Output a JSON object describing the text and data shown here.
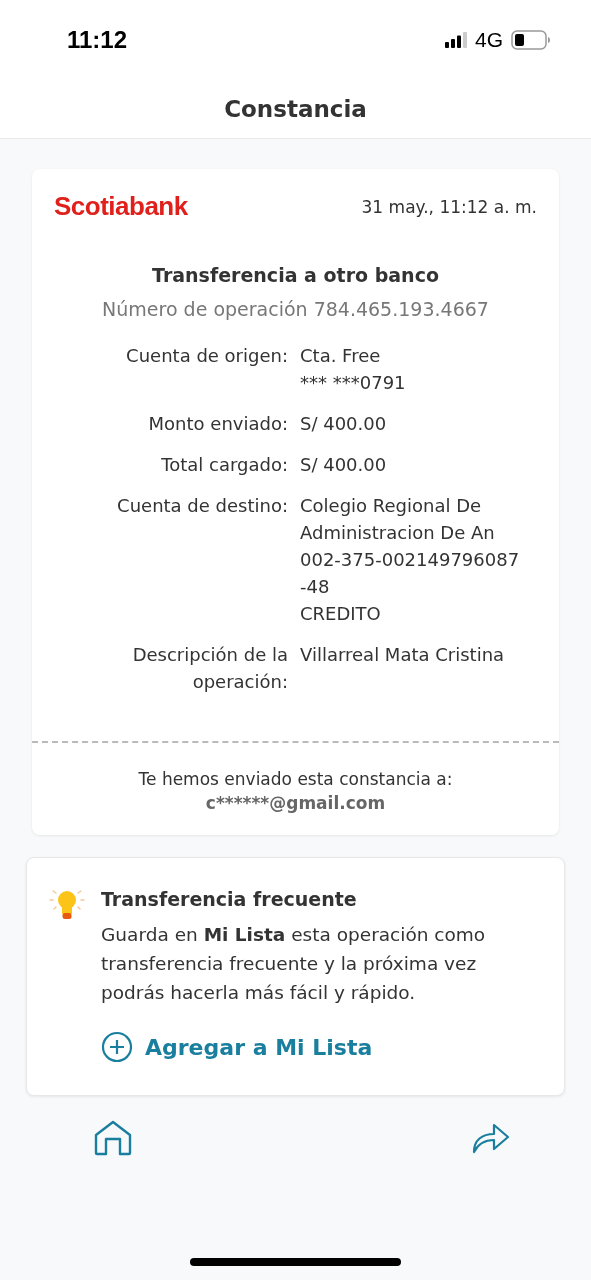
{
  "status_bar": {
    "time": "11:12",
    "network": "4G"
  },
  "header": {
    "title": "Constancia"
  },
  "receipt": {
    "bank": "Scotiabank",
    "date": "31 may., 11:12 a. m.",
    "title": "Transferencia a otro banco",
    "operation_number": "Número de operación 784.465.193.4667",
    "details": [
      {
        "label": "Cuenta de origen:",
        "lines": [
          "Cta. Free",
          "*** ***0791"
        ]
      },
      {
        "label": "Monto enviado:",
        "lines": [
          "S/ 400.00"
        ]
      },
      {
        "label": "Total cargado:",
        "lines": [
          "S/ 400.00"
        ]
      },
      {
        "label": "Cuenta de destino:",
        "lines": [
          "Colegio Regional De",
          "Administracion De An",
          "002-375-002149796087",
          "-48",
          "CREDITO"
        ]
      },
      {
        "label": "Descripción de la operación:",
        "lines": [
          "Villarreal Mata Cristina"
        ]
      }
    ],
    "sent_note": "Te hemos enviado esta constancia a:",
    "email": "c******@gmail.com"
  },
  "tip": {
    "title": "Transferencia frecuente",
    "text": "Guarda en **Mi Lista** esta operación como transferencia frecuente y la próxima vez podrás hacerla más fácil y rápido.",
    "action": "Agregar a Mi Lista"
  },
  "bottom_nav": [
    {
      "kind": "home"
    },
    {
      "kind": "share"
    }
  ]
}
